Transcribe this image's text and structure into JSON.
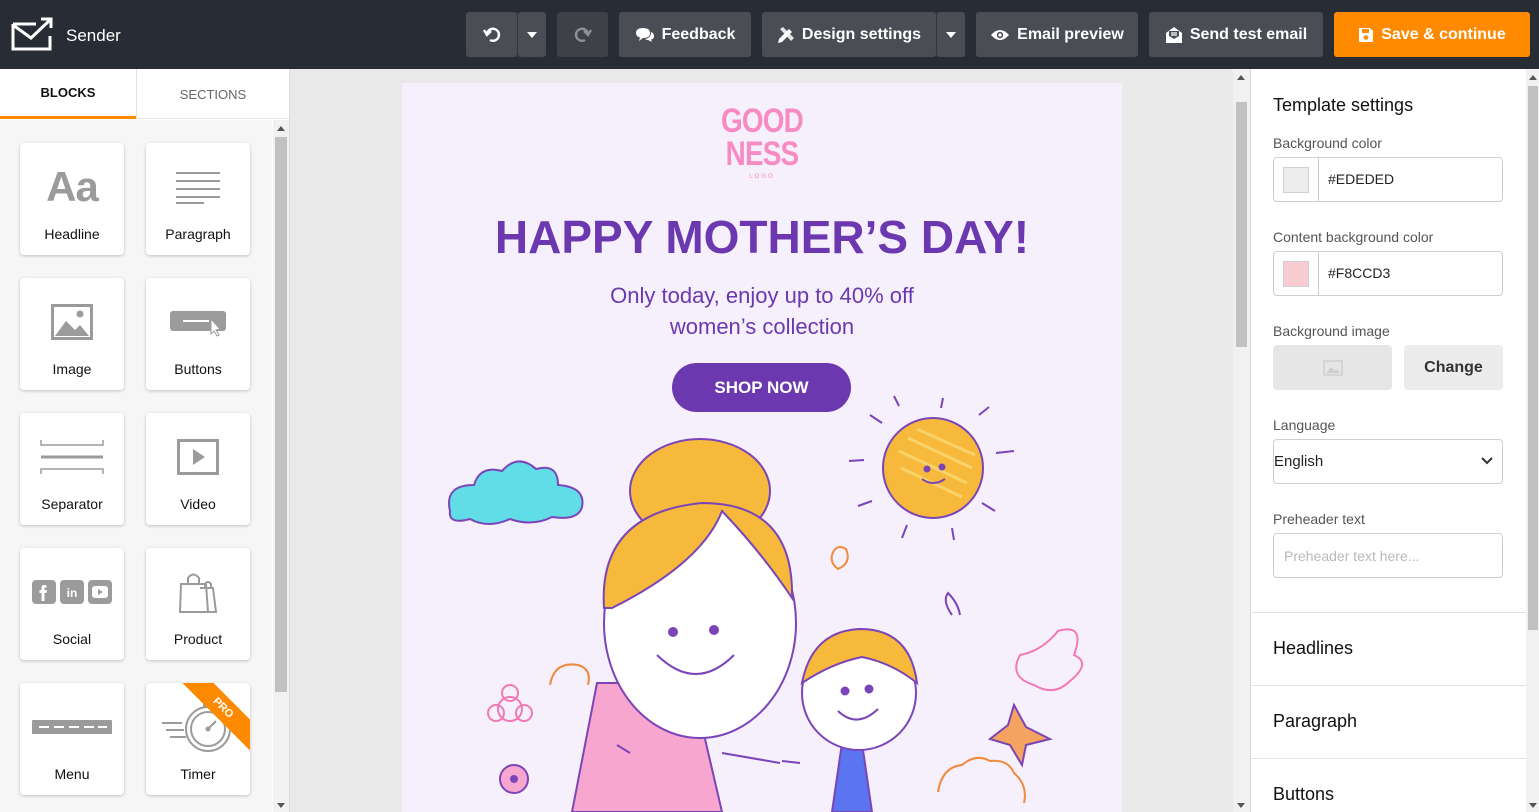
{
  "app": {
    "name": "Sender"
  },
  "toolbar": {
    "feedback_label": "Feedback",
    "design_settings_label": "Design settings",
    "email_preview_label": "Email preview",
    "send_test_label": "Send test email",
    "save_label": "Save & continue"
  },
  "left_panel": {
    "tabs": [
      {
        "label": "BLOCKS",
        "active": true
      },
      {
        "label": "SECTIONS",
        "active": false
      }
    ],
    "blocks": [
      {
        "label": "Headline",
        "icon": "headline-icon"
      },
      {
        "label": "Paragraph",
        "icon": "paragraph-icon"
      },
      {
        "label": "Image",
        "icon": "image-icon"
      },
      {
        "label": "Buttons",
        "icon": "button-icon"
      },
      {
        "label": "Separator",
        "icon": "separator-icon"
      },
      {
        "label": "Video",
        "icon": "video-icon"
      },
      {
        "label": "Social",
        "icon": "social-icon"
      },
      {
        "label": "Product",
        "icon": "shopping-bag-icon"
      },
      {
        "label": "Menu",
        "icon": "menu-icon"
      },
      {
        "label": "Timer",
        "icon": "stopwatch-icon",
        "badge": "PRO"
      }
    ],
    "headline_glyph": "Aa"
  },
  "email": {
    "brand_line1": "GOOD",
    "brand_line2": "NESS",
    "brand_sub": "LOGO",
    "headline": "HAPPY MOTHER’S DAY!",
    "subtext_line1": "Only today, enjoy up to 40% off",
    "subtext_line2": "women’s collection",
    "cta_label": "SHOP NOW",
    "background": "#F6EFFC",
    "accent": "#6B38B0"
  },
  "template_settings": {
    "title": "Template settings",
    "background_color_label": "Background color",
    "background_color_value": "#EDEDED",
    "content_background_label": "Content background color",
    "content_background_value": "#F8CCD3",
    "background_image_label": "Background image",
    "change_label": "Change",
    "language_label": "Language",
    "language_value": "English",
    "preheader_label": "Preheader text",
    "preheader_placeholder": "Preheader text here...",
    "sections": [
      "Headlines",
      "Paragraph",
      "Buttons"
    ]
  },
  "colors": {
    "topbar": "#272C35",
    "button": "#4A4D54",
    "orange": "#FF8A00"
  }
}
